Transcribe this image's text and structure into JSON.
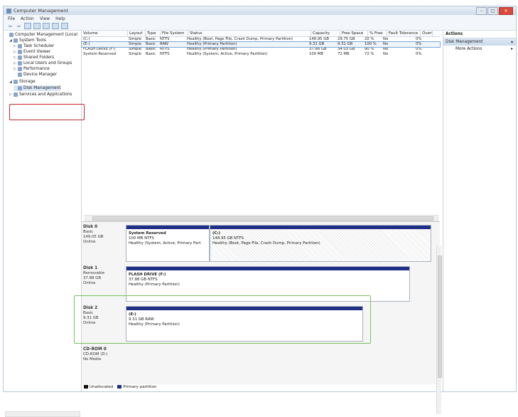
{
  "window": {
    "title": "Computer Management",
    "controls": [
      "–",
      "□",
      "✕"
    ]
  },
  "menu": [
    "File",
    "Action",
    "View",
    "Help"
  ],
  "tree": [
    {
      "label": "Computer Management (Local",
      "indent": 0,
      "arrow": ""
    },
    {
      "label": "System Tools",
      "indent": 1,
      "arrow": "◢"
    },
    {
      "label": "Task Scheduler",
      "indent": 2,
      "arrow": "▷"
    },
    {
      "label": "Event Viewer",
      "indent": 2,
      "arrow": "▷"
    },
    {
      "label": "Shared Folders",
      "indent": 2,
      "arrow": "▷"
    },
    {
      "label": "Local Users and Groups",
      "indent": 2,
      "arrow": "▷"
    },
    {
      "label": "Performance",
      "indent": 2,
      "arrow": "▷"
    },
    {
      "label": "Device Manager",
      "indent": 2,
      "arrow": ""
    },
    {
      "label": "Storage",
      "indent": 1,
      "arrow": "◢"
    },
    {
      "label": "Disk Management",
      "indent": 2,
      "arrow": ""
    },
    {
      "label": "Services and Applications",
      "indent": 1,
      "arrow": "▷"
    }
  ],
  "volumes": {
    "headers": [
      "Volume",
      "Layout",
      "Type",
      "File System",
      "Status",
      "Capacity",
      "Free Space",
      "% Free",
      "Fault Tolerance",
      "Overl"
    ],
    "rows": [
      [
        "(C:)",
        "Simple",
        "Basic",
        "NTFS",
        "Healthy (Boot, Page File, Crash Dump, Primary Partition)",
        "148.95 GB",
        "29.75 GB",
        "20 %",
        "No",
        "0%"
      ],
      [
        "(E:)",
        "Simple",
        "Basic",
        "RAW",
        "Healthy (Primary Partition)",
        "9.31 GB",
        "9.31 GB",
        "100 %",
        "No",
        "0%"
      ],
      [
        "FLASH DRIVE (F:)",
        "Simple",
        "Basic",
        "NTFS",
        "Healthy (Primary Partition)",
        "37.88 GB",
        "34.03 GB",
        "90 %",
        "No",
        "0%"
      ],
      [
        "System Reserved",
        "Simple",
        "Basic",
        "NTFS",
        "Healthy (System, Active, Primary Partition)",
        "100 MB",
        "72 MB",
        "72 %",
        "No",
        "0%"
      ]
    ]
  },
  "disks": [
    {
      "name": "Disk 0",
      "type": "Basic",
      "size": "149.05 GB",
      "status": "Online",
      "partitions": [
        {
          "title": "System Reserved",
          "line2": "100 MB NTFS",
          "line3": "Healthy (System, Active, Primary Part"
        },
        {
          "title": "(C:)",
          "line2": "148.95 GB NTFS",
          "line3": "Healthy (Boot, Page File, Crash Dump, Primary Partition)"
        }
      ]
    },
    {
      "name": "Disk 1",
      "type": "Removable",
      "size": "37.88 GB",
      "status": "Online",
      "partitions": [
        {
          "title": "FLASH DRIVE (F:)",
          "line2": "37.88 GB NTFS",
          "line3": "Healthy (Primary Partition)"
        }
      ]
    },
    {
      "name": "Disk 2",
      "type": "Basic",
      "size": "9.31 GB",
      "status": "Online",
      "partitions": [
        {
          "title": "(E:)",
          "line2": "9.31 GB RAW",
          "line3": "Healthy (Primary Partition)"
        }
      ]
    },
    {
      "name": "CD-ROM 0",
      "type": "CD-ROM (D:)",
      "size": "",
      "status": "No Media",
      "partitions": []
    }
  ],
  "legend": [
    {
      "label": "Unallocated",
      "color": "#111111"
    },
    {
      "label": "Primary partition",
      "color": "#1f2f86"
    }
  ],
  "actions": {
    "title": "Actions",
    "section": "Disk Management",
    "items": [
      "More Actions"
    ]
  },
  "colors": {
    "highlight_red": "#c9262d",
    "highlight_green": "#77c35a",
    "partition_bar": "#1f2f86"
  }
}
